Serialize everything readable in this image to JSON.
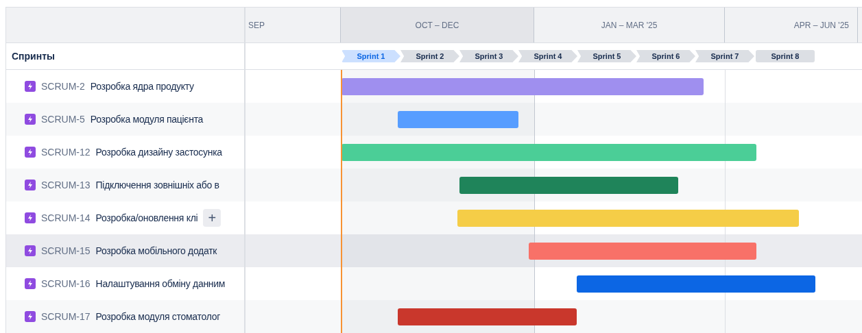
{
  "periods": [
    {
      "label": "SEP",
      "shaded": false
    },
    {
      "label": "OCT – DEC",
      "shaded": true
    },
    {
      "label": "JAN – MAR '25",
      "shaded": false
    },
    {
      "label": "APR – JUN '25",
      "shaded": false
    }
  ],
  "sprints_label": "Спринты",
  "sprints": [
    {
      "label": "Sprint 1",
      "selected": true
    },
    {
      "label": "Sprint 2",
      "selected": false
    },
    {
      "label": "Sprint 3",
      "selected": false
    },
    {
      "label": "Sprint 4",
      "selected": false
    },
    {
      "label": "Sprint 5",
      "selected": false
    },
    {
      "label": "Sprint 6",
      "selected": false
    },
    {
      "label": "Sprint 7",
      "selected": false
    },
    {
      "label": "Sprint 8",
      "selected": false
    }
  ],
  "rows": [
    {
      "key": "SCRUM-2",
      "title": "Розробка ядра продукту",
      "color": "#9f8fef",
      "selected": false
    },
    {
      "key": "SCRUM-5",
      "title": "Розробка модуля пацієнта",
      "color": "#579dff",
      "selected": false
    },
    {
      "key": "SCRUM-12",
      "title": "Розробка дизайну застосунка",
      "color": "#4bce97",
      "selected": false
    },
    {
      "key": "SCRUM-13",
      "title": "Підключення зовнішніх або в",
      "color": "#1f845a",
      "selected": false
    },
    {
      "key": "SCRUM-14",
      "title": "Розробка/оновлення клі",
      "color": "#f5cd47",
      "selected": false,
      "add_button": "+"
    },
    {
      "key": "SCRUM-15",
      "title": "Розробка мобільного додатк",
      "color": "#f87168",
      "selected": true
    },
    {
      "key": "SCRUM-16",
      "title": "Налаштування обміну данним",
      "color": "#0c66e4",
      "selected": false
    },
    {
      "key": "SCRUM-17",
      "title": "Розробка модуля стоматолог",
      "color": "#c9372c",
      "selected": false
    }
  ]
}
